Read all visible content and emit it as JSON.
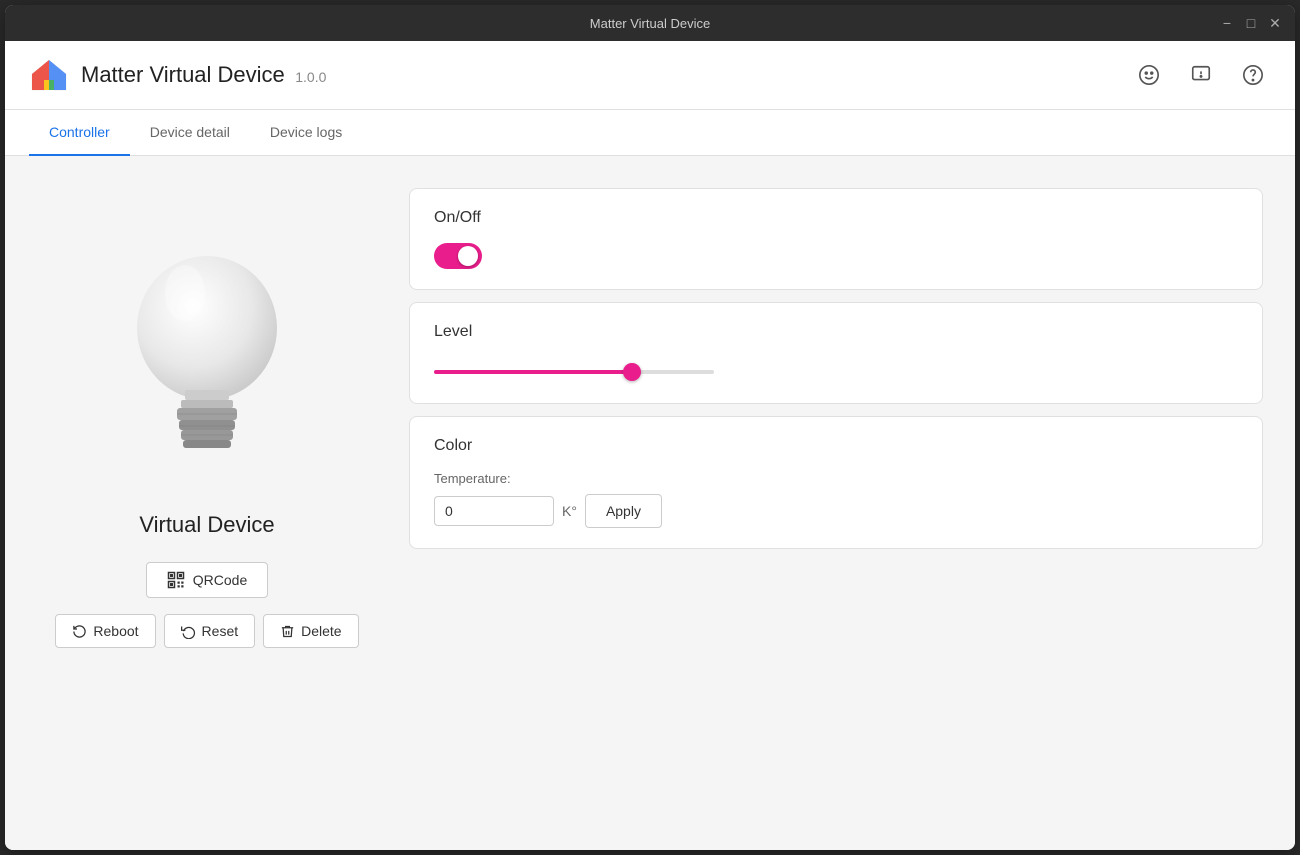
{
  "window": {
    "title": "Matter Virtual Device"
  },
  "titlebar": {
    "title": "Matter Virtual Device",
    "minimize_label": "−",
    "restore_label": "□",
    "close_label": "✕"
  },
  "header": {
    "app_title": "Matter Virtual Device",
    "app_version": "1.0.0",
    "smiley_icon": "☺",
    "feedback_icon": "⚠",
    "help_icon": "?"
  },
  "tabs": [
    {
      "id": "controller",
      "label": "Controller",
      "active": true
    },
    {
      "id": "device-detail",
      "label": "Device detail",
      "active": false
    },
    {
      "id": "device-logs",
      "label": "Device logs",
      "active": false
    }
  ],
  "left_panel": {
    "device_name": "Virtual Device",
    "qrcode_label": "QRCode",
    "reboot_label": "Reboot",
    "reset_label": "Reset",
    "delete_label": "Delete"
  },
  "cards": {
    "onoff": {
      "title": "On/Off",
      "state": true
    },
    "level": {
      "title": "Level",
      "value": 72,
      "min": 0,
      "max": 100
    },
    "color": {
      "title": "Color",
      "temperature_label": "Temperature:",
      "temperature_value": "0",
      "temperature_unit": "K°",
      "apply_label": "Apply"
    }
  }
}
